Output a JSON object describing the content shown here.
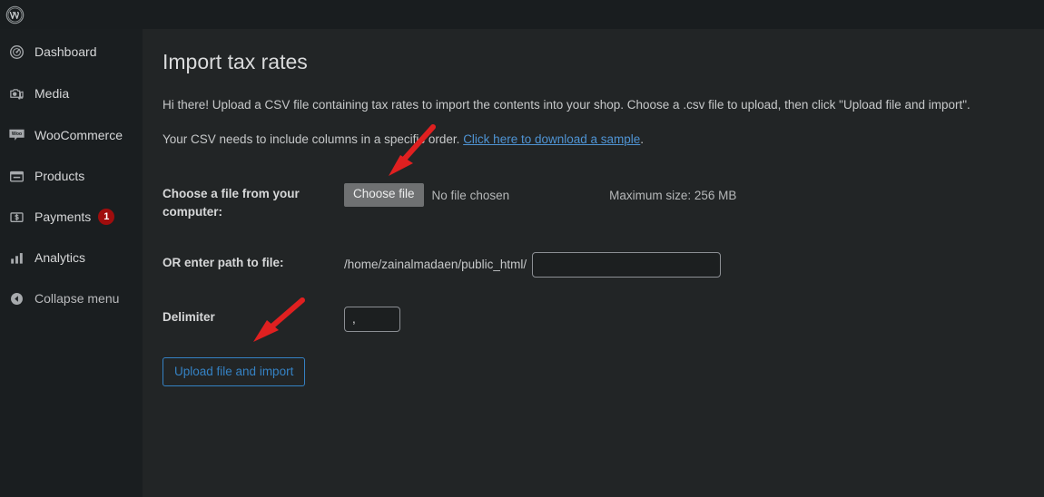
{
  "adminbar": {
    "wp_logo_icon": "wordpress-logo-icon"
  },
  "sidebar": {
    "items": [
      {
        "label": "Dashboard",
        "icon": "dashboard-gauge-icon",
        "badge": null
      },
      {
        "label": "Media",
        "icon": "media-camera-music-icon",
        "badge": null
      },
      {
        "label": "WooCommerce",
        "icon": "woocommerce-icon",
        "badge": null
      },
      {
        "label": "Products",
        "icon": "products-box-icon",
        "badge": null
      },
      {
        "label": "Payments",
        "icon": "payments-dollar-icon",
        "badge": "1"
      },
      {
        "label": "Analytics",
        "icon": "analytics-bars-icon",
        "badge": null
      },
      {
        "label": "Collapse menu",
        "icon": "collapse-arrow-left-icon",
        "badge": null
      }
    ]
  },
  "main": {
    "page_title": "Import tax rates",
    "intro_line1": "Hi there! Upload a CSV file containing tax rates to import the contents into your shop. Choose a .csv file to upload, then click \"Upload file and import\".",
    "intro_line2_prefix": "Your CSV needs to include columns in a specific order. ",
    "intro_link": "Click here to download a sample",
    "intro_line2_suffix": ".",
    "form": {
      "file_label": "Choose a file from your computer:",
      "choose_file_button": "Choose file",
      "no_file_chosen": "No file chosen",
      "max_size": "Maximum size: 256 MB",
      "path_label": "OR enter path to file:",
      "path_prefix": "/home/zainalmadaen/public_html/",
      "path_value": "",
      "path_placeholder": "",
      "delimiter_label": "Delimiter",
      "delimiter_value": ",",
      "submit_button": "Upload file and import"
    }
  },
  "colors": {
    "sidebar_bg": "#1a1e20",
    "content_bg": "#222526",
    "adminbar_bg": "#191d1f",
    "link_blue": "#4f94d4",
    "primary_blue": "#3582c4",
    "badge_red": "#a00d0d",
    "annotation_red": "#e02020"
  }
}
